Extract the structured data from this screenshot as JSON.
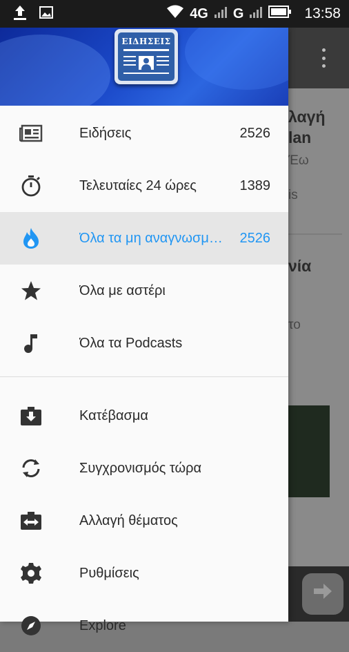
{
  "status_bar": {
    "network_4g": "4G",
    "network_g": "G",
    "time": "13:58",
    "icons": [
      "upload-icon",
      "image-icon",
      "wifi-icon",
      "signal-icon",
      "battery-icon"
    ]
  },
  "drawer": {
    "logo_text": "ΕΙΔΗΣΕΙΣ",
    "feeds": [
      {
        "label": "Ειδήσεις",
        "count": "2526",
        "icon": "newspaper-icon"
      },
      {
        "label": "Τελευταίες 24 ώρες",
        "count": "1389",
        "icon": "stopwatch-icon"
      },
      {
        "label": "Όλα τα μη αναγνωσμένα",
        "count": "2526",
        "icon": "flame-icon",
        "active": true
      },
      {
        "label": "Όλα με αστέρι",
        "count": "",
        "icon": "star-icon"
      },
      {
        "label": "Όλα τα Podcasts",
        "count": "",
        "icon": "music-note-icon"
      }
    ],
    "actions": [
      {
        "label": "Κατέβασμα",
        "icon": "download-box-icon"
      },
      {
        "label": "Συγχρονισμός τώρα",
        "icon": "sync-icon"
      },
      {
        "label": "Αλλαγή θέματος",
        "icon": "swap-theme-icon"
      },
      {
        "label": "Ρυθμίσεις",
        "icon": "gear-icon"
      },
      {
        "label": "Explore",
        "icon": "compass-icon"
      }
    ]
  },
  "background": {
    "title_fragment_1": "λαγή",
    "title_fragment_2": "lan",
    "sub_fragment_1": "Έω",
    "sub_fragment_2": "is",
    "title_fragment_3": "νία",
    "sub_fragment_3": "το"
  },
  "colors": {
    "accent": "#2196f3",
    "header_blue": "#1b49c9",
    "status_bar": "#1b1b1b"
  }
}
